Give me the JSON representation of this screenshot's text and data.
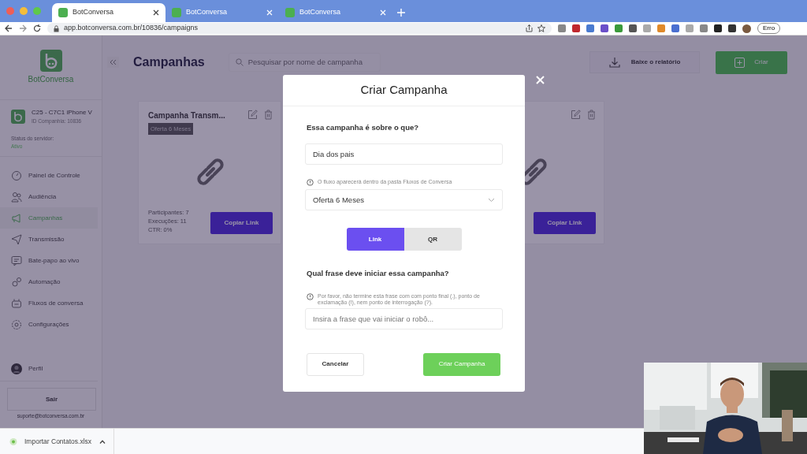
{
  "browser": {
    "tabs": [
      {
        "title": "BotConversa",
        "selected": true
      },
      {
        "title": "BotConversa",
        "selected": false
      },
      {
        "title": "BotConversa",
        "selected": false
      }
    ],
    "url": "app.botconversa.com.br/10836/campaigns",
    "profile_button": "Erro"
  },
  "sidebar": {
    "brand": "BotConversa",
    "account": {
      "name": "C25 - C7C1 iPhone V",
      "id": "ID Companhia: 10836",
      "status_label": "Status do servidor:",
      "status_value": "Ativo"
    },
    "items": [
      {
        "label": "Painel de Controle",
        "kind": "dashboard",
        "selected": false
      },
      {
        "label": "Audiência",
        "kind": "users",
        "selected": false
      },
      {
        "label": "Campanhas",
        "kind": "megaphone",
        "selected": true
      },
      {
        "label": "Transmissão",
        "kind": "send",
        "selected": false
      },
      {
        "label": "Bate-papo ao vivo",
        "kind": "chat",
        "selected": false
      },
      {
        "label": "Automação",
        "kind": "gears",
        "selected": false
      },
      {
        "label": "Fluxos de conversa",
        "kind": "robot",
        "selected": false
      },
      {
        "label": "Configurações",
        "kind": "settings",
        "selected": false
      }
    ],
    "profile": "Perfil",
    "logout": "Sair",
    "support": "suporte@botconversa.com.br"
  },
  "header": {
    "title": "Campanhas",
    "search_placeholder": "Pesquisar por nome de campanha",
    "report_button": "Baixe o relatório",
    "create_button": "Criar"
  },
  "campaigns": [
    {
      "title": "Campanha Transm...",
      "tag": "Oferta 6 Meses",
      "stats": [
        "Participantes: 7",
        "Execuções: 11",
        "CTR: 0%"
      ],
      "button": "Copiar Link"
    },
    {
      "button": "Copiar Link"
    }
  ],
  "modal": {
    "title": "Criar Campanha",
    "topic_label": "Essa campanha é sobre o que?",
    "topic_value": "Dia dos pais",
    "flow_hint": "O fluxo aparecerá dentro da pasta Fluxos de Conversa",
    "flow_value": "Oferta 6 Meses",
    "toggle": [
      {
        "label": "Link",
        "selected": true
      },
      {
        "label": "QR",
        "selected": false
      }
    ],
    "phrase_label": "Qual frase deve iniciar essa campanha?",
    "phrase_hint": "Por favor, não termine esta frase com com ponto final (.), ponto de exclamação (!), nem ponto de interrogação (?).",
    "phrase_placeholder": "Insira a frase que vai iniciar o robô...",
    "cancel_button": "Cancelar",
    "submit_button": "Criar Campanha"
  },
  "downloads": [
    {
      "file": "Importar Contatos.xlsx"
    }
  ]
}
